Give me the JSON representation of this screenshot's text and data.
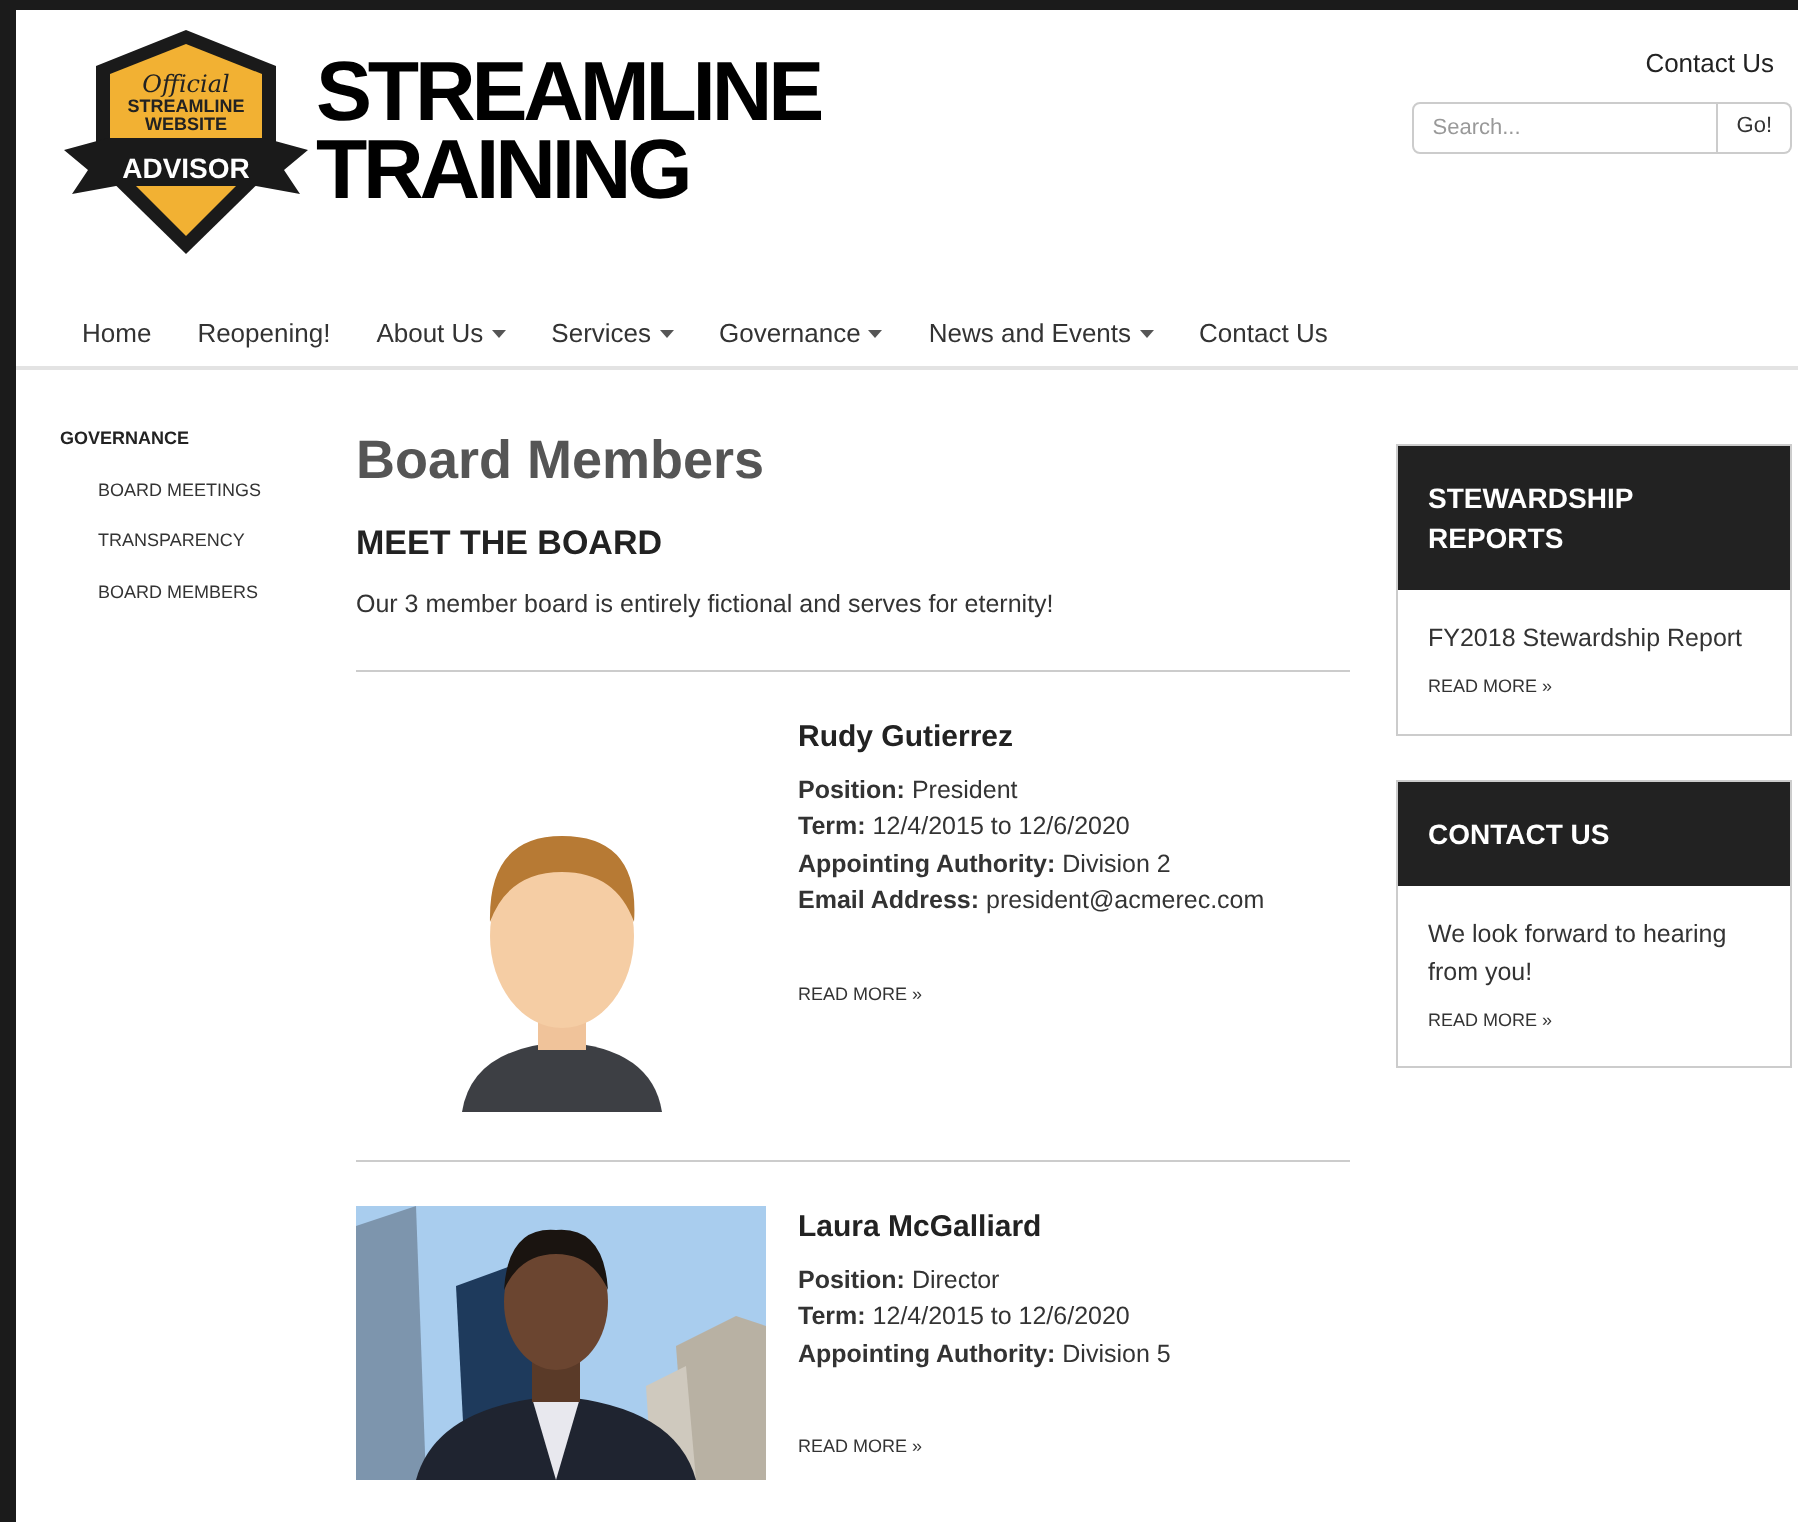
{
  "logo": {
    "badge_script": "Official",
    "badge_line_1": "STREAMLINE",
    "badge_line_2": "WEBSITE",
    "badge_ribbon": "ADVISOR",
    "wordmark_line_1": "STREAMLINE",
    "wordmark_line_2": "TRAINING"
  },
  "top_link": "Contact Us",
  "search": {
    "placeholder": "Search...",
    "button": "Go!"
  },
  "nav": [
    {
      "label": "Home",
      "has_menu": false
    },
    {
      "label": "Reopening!",
      "has_menu": false
    },
    {
      "label": "About Us",
      "has_menu": true
    },
    {
      "label": "Services",
      "has_menu": true
    },
    {
      "label": "Governance",
      "has_menu": true
    },
    {
      "label": "News and Events",
      "has_menu": true
    },
    {
      "label": "Contact Us",
      "has_menu": false
    }
  ],
  "sidebar": {
    "heading": "GOVERNANCE",
    "items": [
      "BOARD MEETINGS",
      "TRANSPARENCY",
      "BOARD MEMBERS"
    ]
  },
  "page_title": "Board Members",
  "section_title": "MEET THE BOARD",
  "intro": "Our 3 member board is entirely fictional and serves for eternity!",
  "members": [
    {
      "name": "Rudy Gutierrez",
      "image": {
        "kind": "avatar"
      },
      "fields": [
        {
          "label": "Position:",
          "value": "President"
        },
        {
          "label": "Term:",
          "value": "12/4/2015 to 12/6/2020"
        },
        {
          "label": "Appointing Authority:",
          "value": "Division 2"
        },
        {
          "label": "Email Address:",
          "value": "president@acmerec.com"
        }
      ],
      "read_more": "READ MORE »"
    },
    {
      "name": "Laura McGalliard",
      "image": {
        "kind": "picture"
      },
      "fields": [
        {
          "label": "Position:",
          "value": "Director"
        },
        {
          "label": "Term:",
          "value": "12/4/2015 to 12/6/2020"
        },
        {
          "label": "Appointing Authority:",
          "value": "Division 5"
        }
      ],
      "read_more": "READ MORE »"
    }
  ],
  "widgets": [
    {
      "title": "STEWARDSHIP REPORTS",
      "body": "FY2018 Stewardship Report",
      "read_more": "READ MORE »"
    },
    {
      "title": "CONTACT US",
      "body": "We look forward to hearing from you!",
      "read_more": "READ MORE »"
    }
  ]
}
